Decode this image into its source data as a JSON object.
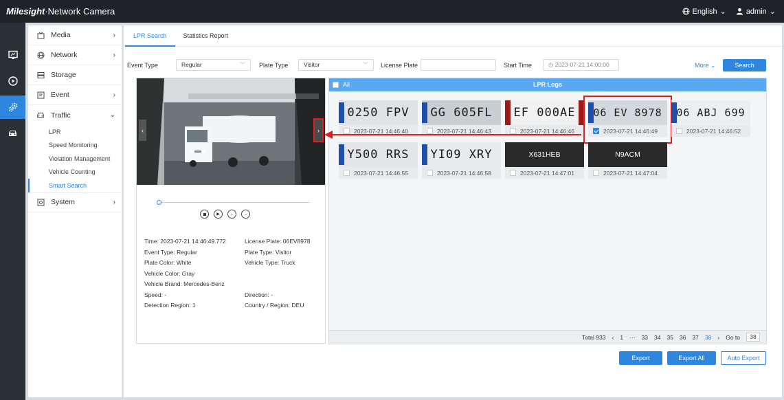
{
  "header": {
    "brand_bold": "Milesight",
    "brand_rest": "·Network Camera",
    "language": "English",
    "user": "admin"
  },
  "sidebar": {
    "media": "Media",
    "network": "Network",
    "storage": "Storage",
    "event": "Event",
    "traffic": "Traffic",
    "sub": [
      "LPR",
      "Speed Monitoring",
      "Violation Management",
      "Vehicle Counting",
      "Smart Search"
    ],
    "system": "System"
  },
  "tabs": [
    "LPR Search",
    "Statistics Report"
  ],
  "filters": {
    "event_type_label": "Event Type",
    "event_type_value": "Regular",
    "plate_type_label": "Plate Type",
    "plate_type_value": "Visitor",
    "license_plate_label": "License Plate",
    "license_plate_value": "",
    "start_time_label": "Start Time",
    "start_time_value": "2023-07-21 14:00:00",
    "more": "More",
    "search": "Search"
  },
  "details": {
    "time": "Time: 2023-07-21 14:46:49.772",
    "license_plate": "License Plate: 06EV8978",
    "event_type": "Event Type: Regular",
    "plate_type": "Plate Type: Visitor",
    "plate_color": "Plate Color: White",
    "vehicle_type": "Vehicle Type: Truck",
    "vehicle_color": "Vehicle Color: Gray",
    "vehicle_brand": "Vehicle Brand: Mercedes-Benz",
    "speed": "Speed: -",
    "direction": "Direction: -",
    "detection_region": "Detection Region: 1",
    "country": "Country / Region: DEU"
  },
  "logs": {
    "all_label": "All",
    "title": "LPR Logs",
    "cards": [
      {
        "plate": "0250 FPV",
        "time": "2023-07-21 14:46:40"
      },
      {
        "plate": "GG 605FL",
        "time": "2023-07-21 14:46:43"
      },
      {
        "plate": "EF 000AE",
        "time": "2023-07-21 14:46:46"
      },
      {
        "plate": "06 EV 8978",
        "time": "2023-07-21 14:46:49"
      },
      {
        "plate": "06 ABJ 699",
        "time": "2023-07-21 14:46:52"
      },
      {
        "plate": "Y500 RRS",
        "time": "2023-07-21 14:46:55"
      },
      {
        "plate": "YI09 XRY",
        "time": "2023-07-21 14:46:58"
      },
      {
        "plate": "X631HEB",
        "time": "2023-07-21 14:47:01"
      },
      {
        "plate": "N9ACM",
        "time": "2023-07-21 14:47:04"
      }
    ]
  },
  "pager": {
    "total": "Total 933",
    "prev": "‹",
    "p1": "1",
    "dots": "···",
    "pages": [
      "33",
      "34",
      "35",
      "36",
      "37",
      "38"
    ],
    "next": "›",
    "goto_label": "Go to",
    "goto_value": "38"
  },
  "actions": {
    "export": "Export",
    "export_all": "Export All",
    "auto_export": "Auto Export"
  },
  "colors": {
    "accent": "#2e86de",
    "highlight": "#e02020",
    "topbar": "#1f2328"
  }
}
